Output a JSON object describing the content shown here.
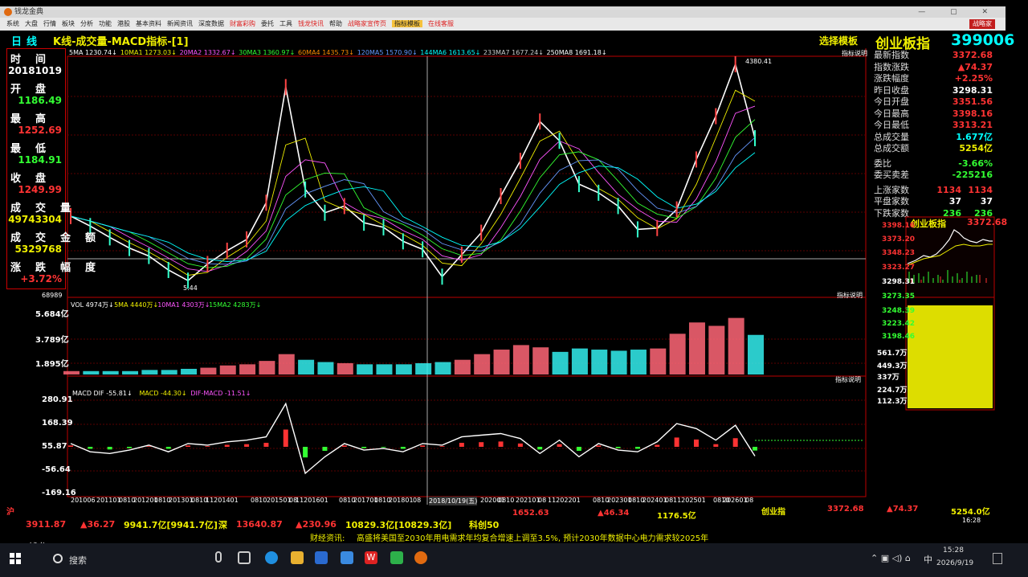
{
  "window": {
    "title": "钱龙金典",
    "controls": "— ▢ ✕"
  },
  "menu": [
    {
      "label": "系统"
    },
    {
      "label": "大盘"
    },
    {
      "label": "行情"
    },
    {
      "label": "板块"
    },
    {
      "label": "分析"
    },
    {
      "label": "功能"
    },
    {
      "label": "港股"
    },
    {
      "label": "基本资料"
    },
    {
      "label": "新闻资讯"
    },
    {
      "label": "深度数据"
    },
    {
      "label": "财富彩购",
      "style": "red"
    },
    {
      "label": "委托"
    },
    {
      "label": "工具"
    },
    {
      "label": "钱龙快讯",
      "style": "red"
    },
    {
      "label": "帮助"
    },
    {
      "label": "战略家宣传页",
      "style": "red"
    },
    {
      "label": "指标模板",
      "style": "hl"
    },
    {
      "label": "在线客服",
      "style": "red"
    }
  ],
  "menu_brand": "战略家",
  "header": {
    "period": "日线",
    "title": "K线-成交量-MACD指标-[1]",
    "select_template": "选择模板",
    "index_name": "创业板指",
    "index_code": "399006"
  },
  "left_panel": [
    {
      "label": "时间",
      "value": "20181019",
      "color": "#ffffff"
    },
    {
      "label": "开盘",
      "value": "1186.49",
      "color": "#33ff33"
    },
    {
      "label": "最高",
      "value": "1252.69",
      "color": "#ff3333"
    },
    {
      "label": "最低",
      "value": "1184.91",
      "color": "#33ff33"
    },
    {
      "label": "收盘",
      "value": "1249.99",
      "color": "#ff3333"
    },
    {
      "label": "成交量",
      "value": "49743304",
      "color": "#f0f000"
    },
    {
      "label": "成交金额",
      "value": "5329768",
      "color": "#f0f000"
    },
    {
      "label": "涨跌幅度",
      "value": "+3.72%",
      "color": "#ff3333"
    }
  ],
  "ma_legend": [
    {
      "text": "5MA 1230.74",
      "color": "#ffffff"
    },
    {
      "text": "10MA1 1273.03",
      "color": "#f0f000"
    },
    {
      "text": "20MA2 1332.67",
      "color": "#ff55ff"
    },
    {
      "text": "30MA3 1360.97",
      "color": "#33ff33"
    },
    {
      "text": "60MA4 1435.73",
      "color": "#ff8c00"
    },
    {
      "text": "120MA5 1570.90",
      "color": "#6699ff"
    },
    {
      "text": "144MA6 1613.65",
      "color": "#00ffff"
    },
    {
      "text": "233MA7 1677.24",
      "color": "#cccccc"
    },
    {
      "text": "250MA8 1691.18",
      "color": "#ffffff"
    }
  ],
  "indicator_note": "指标说明",
  "price_marks": {
    "high": "4380.41",
    "low": "5.44",
    "top_scale": "68989"
  },
  "volume_panel": {
    "legend": [
      {
        "text": "VOL 4974万",
        "color": "#ffffff"
      },
      {
        "text": "5MA 4440万",
        "color": "#f0f000"
      },
      {
        "text": "10MA1 4303万",
        "color": "#ff55ff"
      },
      {
        "text": "15MA2 4283万",
        "color": "#33ff33"
      }
    ],
    "axis": [
      "5.684亿",
      "3.789亿",
      "1.895亿"
    ]
  },
  "macd_panel": {
    "legend": [
      {
        "text": "MACD DIF -55.81",
        "color": "#ffffff"
      },
      {
        "text": "MACD -44.30",
        "color": "#f0f000"
      },
      {
        "text": "DIF-MACD -11.51",
        "color": "#ff55ff"
      }
    ],
    "axis": [
      "280.91",
      "168.39",
      "55.87",
      "-56.64",
      "-169.16"
    ]
  },
  "x_axis": [
    "201006",
    "201101",
    "0810",
    "201201",
    "0810",
    "201301",
    "0810",
    "11201401",
    "0810",
    "201501",
    "08",
    "11201601",
    "0810",
    "201701",
    "0810",
    "201801",
    "08",
    "2018/10/19(五)",
    "202001",
    "0810",
    "202101",
    "08",
    "11202201",
    "0810",
    "202301",
    "0810",
    "202401",
    "08",
    "11202501",
    "0810",
    "202601",
    "08"
  ],
  "right_panel": [
    {
      "label": "最新指数",
      "value": "3372.68",
      "color": "#ff3333"
    },
    {
      "label": "指数涨跌",
      "value": "▲74.37",
      "color": "#ff3333"
    },
    {
      "label": "涨跌幅度",
      "value": "+2.25%",
      "color": "#ff3333"
    },
    {
      "label": "昨日收盘",
      "value": "3298.31",
      "color": "#ffffff"
    },
    {
      "label": "今日开盘",
      "value": "3351.56",
      "color": "#ff3333"
    },
    {
      "label": "今日最高",
      "value": "3398.16",
      "color": "#ff3333"
    },
    {
      "label": "今日最低",
      "value": "3313.21",
      "color": "#ff3333"
    },
    {
      "label": "总成交量",
      "value": "1.677亿",
      "color": "#00ffff"
    },
    {
      "label": "总成交额",
      "value": "5254亿",
      "color": "#f0f000"
    },
    {
      "label": "委比",
      "value": "-3.66%",
      "color": "#33ff33"
    },
    {
      "label": "委买卖差",
      "value": "-225216",
      "color": "#33ff33"
    },
    {
      "label": "上涨家数",
      "value": "1134",
      "value2": "1134",
      "color": "#ff3333"
    },
    {
      "label": "平盘家数",
      "value": "37",
      "value2": "37",
      "color": "#ffffff"
    },
    {
      "label": "下跌家数",
      "value": "236",
      "value2": "236",
      "color": "#33ff33"
    }
  ],
  "mini_chart": {
    "title": "创业板指",
    "value": "3372.68",
    "axis": [
      "3398.16",
      "3373.20",
      "3348.23",
      "3323.27",
      "3298.31",
      "3273.35",
      "3248.39",
      "3223.42",
      "3198.46"
    ],
    "vol_axis": [
      "561.7万",
      "449.3万",
      "337万",
      "224.7万",
      "112.3万"
    ]
  },
  "bottom_bar": {
    "name": "创业指",
    "price": "3372.68",
    "change": "▲74.37",
    "amount": "5254.0亿",
    "deep": "深",
    "deep_val": "13640.87",
    "deep_change": "▲230.96",
    "deep_amount": "10829.3亿[10829.3亿]",
    "science": "科创50",
    "science_val": "1652.63",
    "science_change": "▲46.34",
    "science_amount": "1176.5亿",
    "sh": "沪",
    "sh_val": "3911.87",
    "sh_change": "▲36.27",
    "sh_amount": "9941.7亿[9941.7亿]"
  },
  "news": {
    "label": "财经资讯:",
    "text": "高盛将美国至2030年用电需求年均复合增速上调至3.5%, 预计2030年数据中心电力需求较2025年"
  },
  "status": {
    "logo": "钱龙",
    "time": "16:28"
  },
  "taskbar": {
    "search": "搜索",
    "time": "15:28",
    "date": "2026/9/19",
    "ime": "中"
  },
  "chart_data": {
    "type": "line",
    "title": "K线-成交量-MACD指标-[1]",
    "series": [
      {
        "name": "创业板指",
        "values": [
          2100,
          1950,
          1780,
          1620,
          1500,
          1290,
          1130,
          1380,
          1580,
          1750,
          2300,
          4037,
          2500,
          2150,
          2250,
          2000,
          1930,
          1720,
          1600,
          1190,
          1520,
          1850,
          2400,
          2930,
          3520,
          3230,
          2580,
          2450,
          2250,
          1900,
          1920,
          2200,
          2950,
          3600,
          4380,
          3270
        ]
      },
      {
        "name": "VOL",
        "values": [
          0.3,
          0.3,
          0.3,
          0.3,
          0.4,
          0.4,
          0.5,
          0.6,
          0.8,
          0.9,
          1.2,
          1.8,
          1.3,
          1.1,
          1.0,
          0.9,
          0.9,
          0.9,
          1.0,
          1.1,
          1.3,
          1.8,
          2.2,
          2.6,
          2.4,
          2.0,
          2.3,
          2.2,
          2.1,
          2.2,
          2.3,
          3.6,
          4.6,
          4.3,
          5.0,
          3.5
        ]
      },
      {
        "name": "MACD DIF",
        "values": [
          20,
          -30,
          -40,
          -20,
          10,
          -30,
          20,
          10,
          30,
          40,
          60,
          260,
          -160,
          -60,
          20,
          -20,
          -10,
          -30,
          20,
          10,
          60,
          70,
          80,
          50,
          -40,
          40,
          -60,
          20,
          -20,
          -30,
          30,
          140,
          110,
          40,
          130,
          -55.81
        ]
      }
    ],
    "ylim_price": [
      -169.16,
      280.91
    ]
  }
}
